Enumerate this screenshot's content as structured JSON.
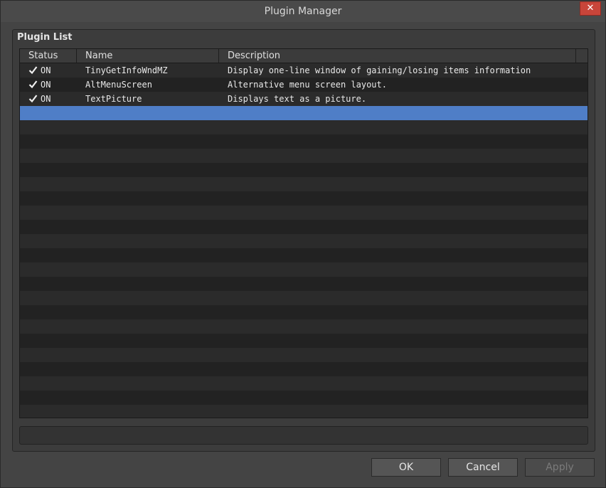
{
  "window": {
    "title": "Plugin Manager",
    "close_label": "✕"
  },
  "group": {
    "title": "Plugin List"
  },
  "table": {
    "headers": {
      "status": "Status",
      "name": "Name",
      "description": "Description"
    },
    "rows": [
      {
        "checked": true,
        "status": "ON",
        "name": "TinyGetInfoWndMZ",
        "description": "Display one-line window of gaining/losing items information"
      },
      {
        "checked": true,
        "status": "ON",
        "name": "AltMenuScreen",
        "description": "Alternative menu screen layout."
      },
      {
        "checked": true,
        "status": "ON",
        "name": "TextPicture",
        "description": "Displays text as a picture."
      }
    ],
    "selected_row_index": 3
  },
  "buttons": {
    "ok": "OK",
    "cancel": "Cancel",
    "apply": "Apply"
  },
  "colors": {
    "selection": "#4f7ec7",
    "close": "#c8453a"
  }
}
